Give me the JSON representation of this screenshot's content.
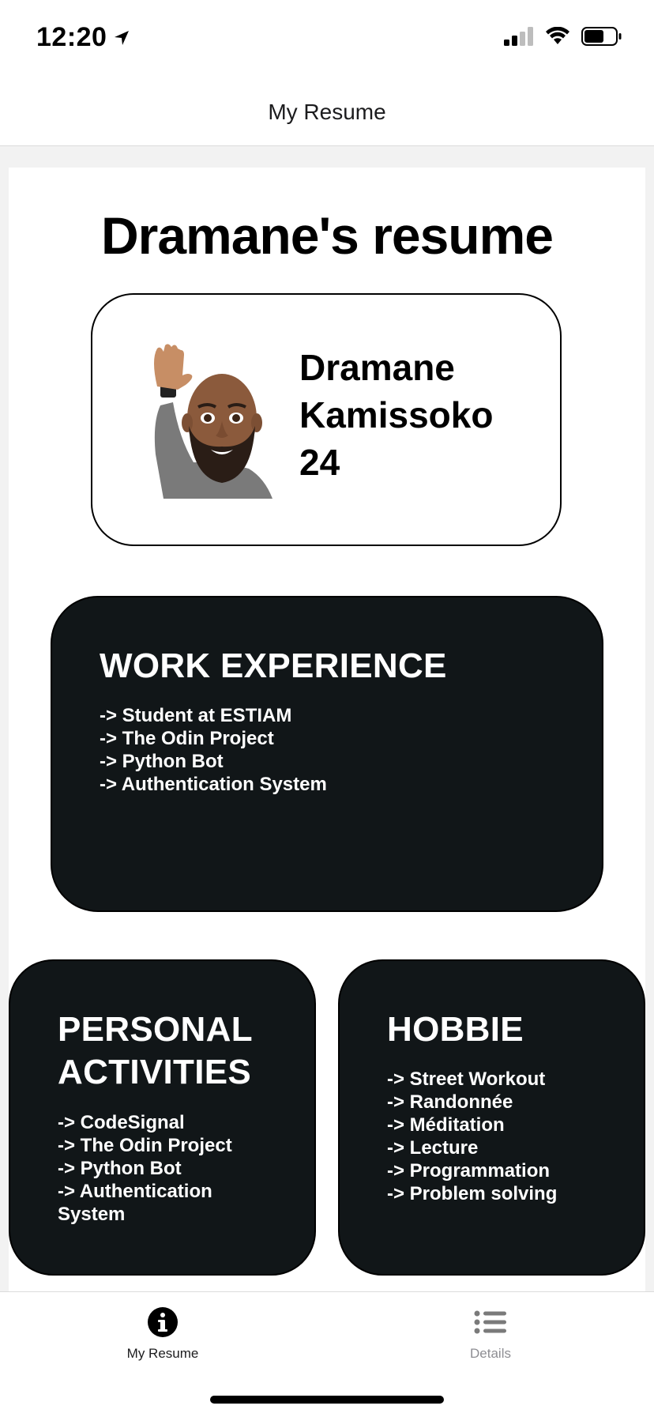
{
  "status_bar": {
    "time": "12:20",
    "location_icon": "location-arrow-icon",
    "signal_icon": "cellular-signal-icon",
    "wifi_icon": "wifi-icon",
    "battery_icon": "battery-icon"
  },
  "nav": {
    "title": "My Resume"
  },
  "page": {
    "title": "Dramane's resume"
  },
  "profile": {
    "avatar_icon": "memoji-avatar-icon",
    "first_name": "Dramane",
    "last_name": "Kamissoko",
    "age": "24"
  },
  "work_experience": {
    "heading": "WORK EXPERIENCE",
    "items": [
      "-> Student at ESTIAM",
      "-> The Odin Project",
      "-> Python Bot",
      "-> Authentication System"
    ]
  },
  "personal_activities": {
    "heading": "PERSONAL ACTIVITIES",
    "items": [
      "-> CodeSignal",
      "-> The Odin Project",
      "-> Python Bot",
      "-> Authentication System"
    ]
  },
  "hobbies": {
    "heading": "HOBBIE",
    "items": [
      "-> Street Workout",
      "-> Randonnée",
      "-> Méditation",
      "-> Lecture",
      "-> Programmation",
      "-> Problem solving"
    ]
  },
  "tab_bar": {
    "tabs": [
      {
        "label": "My Resume",
        "icon": "info-circle-icon",
        "active": true
      },
      {
        "label": "Details",
        "icon": "list-icon",
        "active": false
      }
    ]
  },
  "colors": {
    "card_background": "#111618",
    "card_text": "#ffffff",
    "active_tab": "#1c1c1e",
    "inactive_tab": "#8e8e93"
  }
}
